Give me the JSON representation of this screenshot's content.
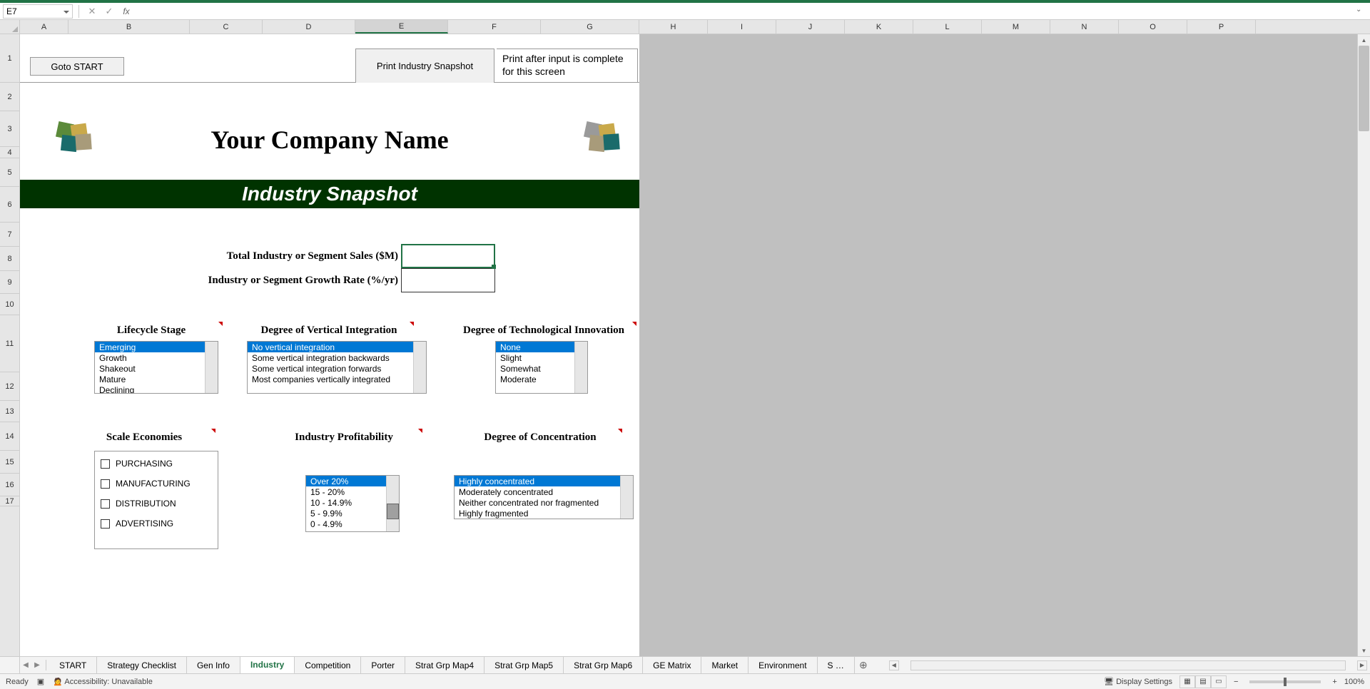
{
  "name_box": "E7",
  "formula_value": "",
  "columns": [
    "A",
    "B",
    "C",
    "D",
    "E",
    "F",
    "G",
    "H",
    "I",
    "J",
    "K",
    "L",
    "M",
    "N",
    "O",
    "P"
  ],
  "active_column": "E",
  "rows": [
    "1",
    "2",
    "3",
    "4",
    "5",
    "6",
    "7",
    "8",
    "9",
    "10",
    "11",
    "12",
    "13",
    "14",
    "15",
    "16",
    "17"
  ],
  "buttons": {
    "goto_start": "Goto START",
    "print_snapshot": "Print Industry Snapshot",
    "print_note": "Print after input is complete for this screen"
  },
  "company_title": "Your Company Name",
  "banner": "Industry Snapshot",
  "inputs": {
    "total_sales_label": "Total Industry or Segment Sales ($M)",
    "growth_rate_label": "Industry or Segment Growth Rate (%/yr)"
  },
  "sections1": {
    "lifecycle": {
      "title": "Lifecycle Stage",
      "items": [
        "Emerging",
        "Growth",
        "Shakeout",
        "Mature",
        "Declining"
      ],
      "selected": 0
    },
    "vertical": {
      "title": "Degree of Vertical Integration",
      "items": [
        "No vertical integration",
        "Some vertical integration backwards",
        "Some vertical integration forwards",
        "Most companies vertically integrated"
      ],
      "selected": 0
    },
    "tech": {
      "title": "Degree of Technological Innovation",
      "items": [
        "None",
        "Slight",
        "Somewhat",
        "Moderate"
      ],
      "selected": 0
    }
  },
  "sections2": {
    "scale": {
      "title": "Scale Economies",
      "items": [
        "PURCHASING",
        "MANUFACTURING",
        "DISTRIBUTION",
        "ADVERTISING"
      ]
    },
    "profit": {
      "title": "Industry Profitability",
      "items": [
        "Over 20%",
        "15 - 20%",
        "10 - 14.9%",
        "  5 - 9.9%",
        "  0 - 4.9%"
      ],
      "selected": 0
    },
    "conc": {
      "title": "Degree of Concentration",
      "items": [
        "Highly concentrated",
        "Moderately concentrated",
        "Neither concentrated nor fragmented",
        "Highly fragmented"
      ],
      "selected": 0
    }
  },
  "tabs": [
    "START",
    "Strategy Checklist",
    "Gen Info",
    "Industry",
    "Competition",
    "Porter",
    "Strat Grp Map4",
    "Strat Grp Map5",
    "Strat Grp Map6",
    "GE Matrix",
    "Market",
    "Environment",
    "S …"
  ],
  "active_tab": "Industry",
  "status": {
    "ready": "Ready",
    "accessibility": "Accessibility: Unavailable",
    "display_settings": "Display Settings",
    "zoom": "100%"
  }
}
